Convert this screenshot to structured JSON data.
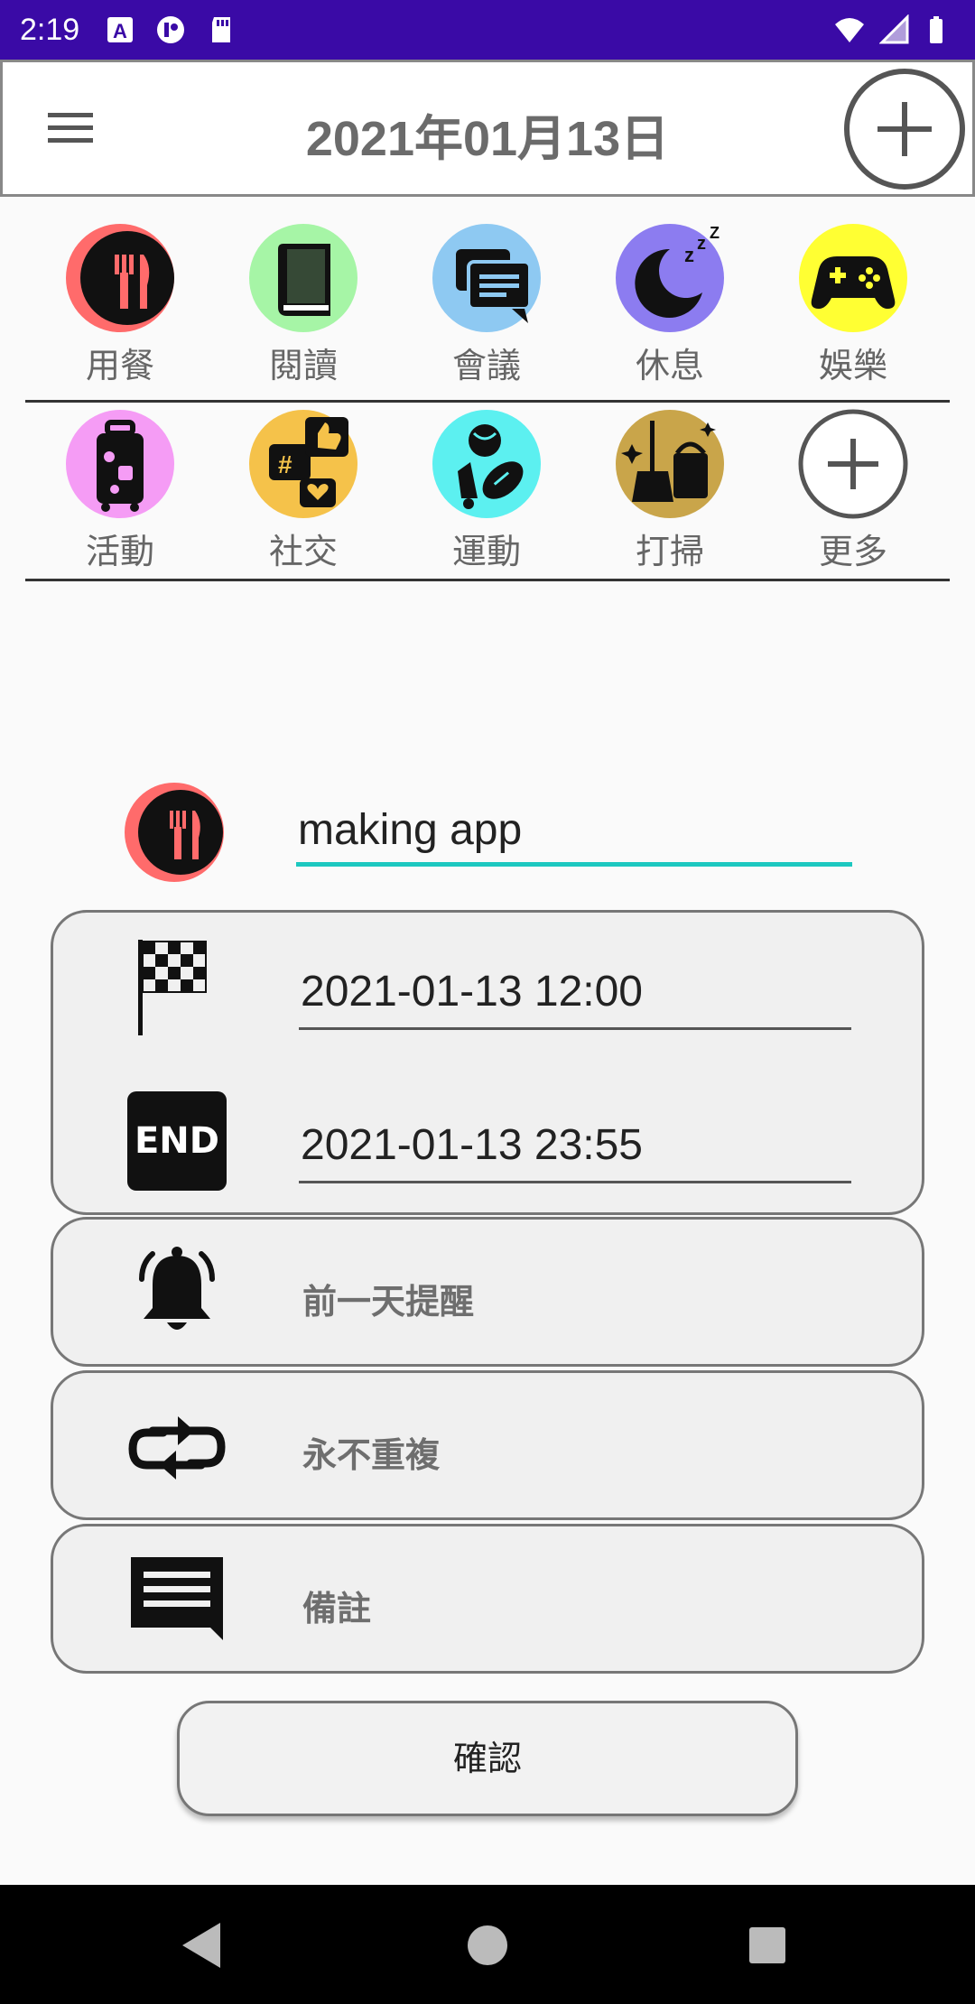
{
  "status_bar": {
    "time": "2:19",
    "left_icons": [
      "accessibility-icon",
      "media-icon",
      "sd-card-icon"
    ],
    "right_icons": [
      "wifi-icon",
      "signal-icon",
      "battery-icon"
    ]
  },
  "header": {
    "title": "2021年01月13日",
    "menu_icon": "menu-icon",
    "add_icon": "add-circle-icon"
  },
  "categories_row1": [
    {
      "label": "用餐",
      "icon": "dining-icon",
      "color": "#ff6b6b"
    },
    {
      "label": "閱讀",
      "icon": "book-icon",
      "color": "#a6f5a6"
    },
    {
      "label": "會議",
      "icon": "chat-icon",
      "color": "#8ec9f2"
    },
    {
      "label": "休息",
      "icon": "sleep-icon",
      "color": "#8c7cf0"
    },
    {
      "label": "娛樂",
      "icon": "gamepad-icon",
      "color": "#ffff33"
    }
  ],
  "categories_row2": [
    {
      "label": "活動",
      "icon": "luggage-icon",
      "color": "#f59cf5"
    },
    {
      "label": "社交",
      "icon": "social-icon",
      "color": "#f5c24a"
    },
    {
      "label": "運動",
      "icon": "sports-icon",
      "color": "#5cf0f0"
    },
    {
      "label": "打掃",
      "icon": "cleaning-icon",
      "color": "#c9a54a"
    },
    {
      "label": "更多",
      "icon": "add-circle-icon",
      "color": "#ffffff"
    }
  ],
  "event": {
    "name_value": "making app",
    "selected_category_icon": "dining-icon",
    "start_time": "2021-01-13 12:00",
    "end_time": "2021-01-13 23:55",
    "end_badge": "END",
    "reminder": "前一天提醒",
    "repeat": "永不重複",
    "note": "備註"
  },
  "confirm_label": "確認",
  "accent_color": "#1cc8c0",
  "status_bar_color": "#3a0aa6"
}
